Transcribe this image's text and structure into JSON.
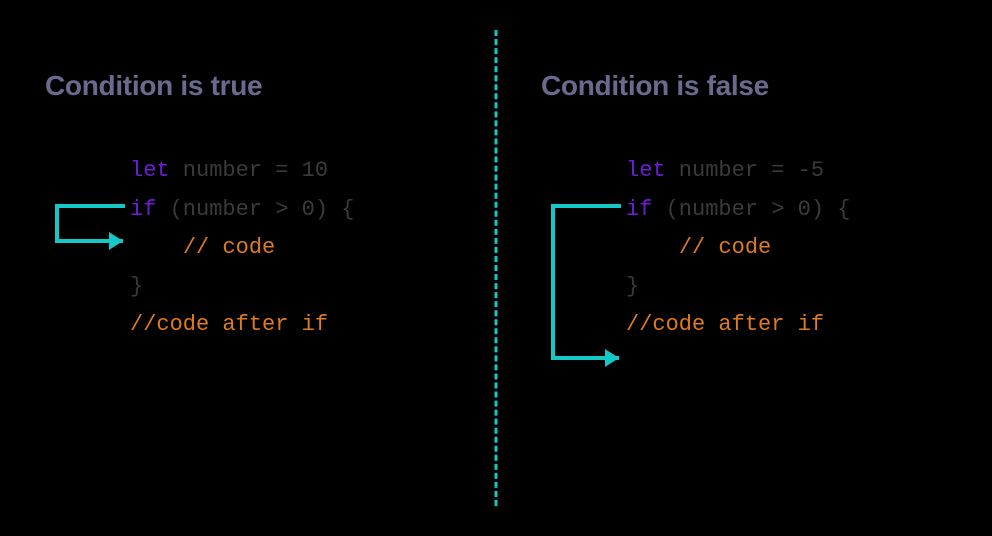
{
  "left": {
    "heading": "Condition is true",
    "code": {
      "l1_kw": "let",
      "l1_rest": " number = 10",
      "l2_kw": "if",
      "l2_rest": " (number > 0) {",
      "l3_indent": "    ",
      "l3_cm": "// code",
      "l4": "}",
      "l5": "",
      "l6_cm": "//code after if"
    }
  },
  "right": {
    "heading": "Condition is false",
    "code": {
      "l1_kw": "let",
      "l1_rest": " number = -5",
      "l2_kw": "if",
      "l2_rest": " (number > 0) {",
      "l3_indent": "    ",
      "l3_cm": "// code",
      "l4": "}",
      "l5": "",
      "l6_cm": "//code after if"
    }
  },
  "colors": {
    "arrow": "#14c8c8",
    "keyword": "#6b1ed6",
    "comment": "#e07a1f",
    "heading": "#6b6a8e",
    "code": "#3a3a3a"
  }
}
